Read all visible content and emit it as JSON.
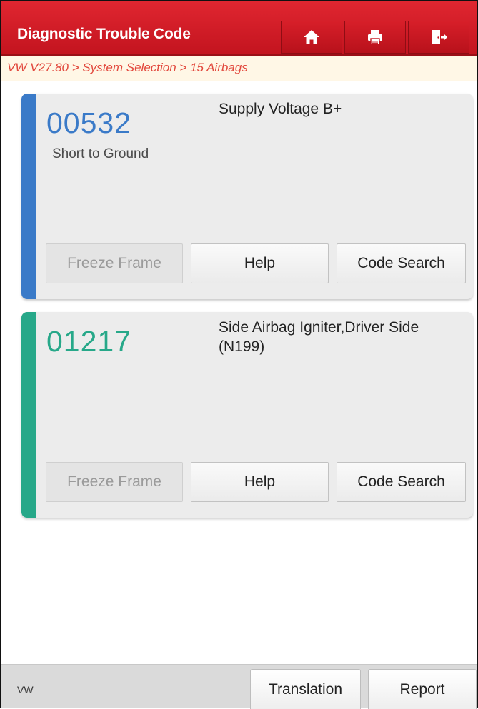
{
  "header": {
    "title": "Diagnostic Trouble Code",
    "buttons": [
      {
        "name": "home",
        "icon": "home-icon"
      },
      {
        "name": "print",
        "icon": "printer-icon"
      },
      {
        "name": "exit",
        "icon": "exit-icon"
      }
    ],
    "background_color": "#d21c26"
  },
  "breadcrumb": {
    "text": "VW V27.80 > System Selection > 15 Airbags",
    "color": "#e2483d"
  },
  "dtc_list": [
    {
      "code": "00532",
      "status": "Short to Ground",
      "description": "Supply Voltage B+",
      "accent_color": "#3a7ac8",
      "buttons": {
        "freeze_frame": "Freeze Frame",
        "help": "Help",
        "code_search": "Code Search"
      }
    },
    {
      "code": "01217",
      "status": "",
      "description": "Side Airbag Igniter,Driver Side (N199)",
      "accent_color": "#27a889",
      "buttons": {
        "freeze_frame": "Freeze Frame",
        "help": "Help",
        "code_search": "Code Search"
      }
    }
  ],
  "footer": {
    "vehicle": "VW",
    "translation_label": "Translation",
    "report_label": "Report"
  }
}
